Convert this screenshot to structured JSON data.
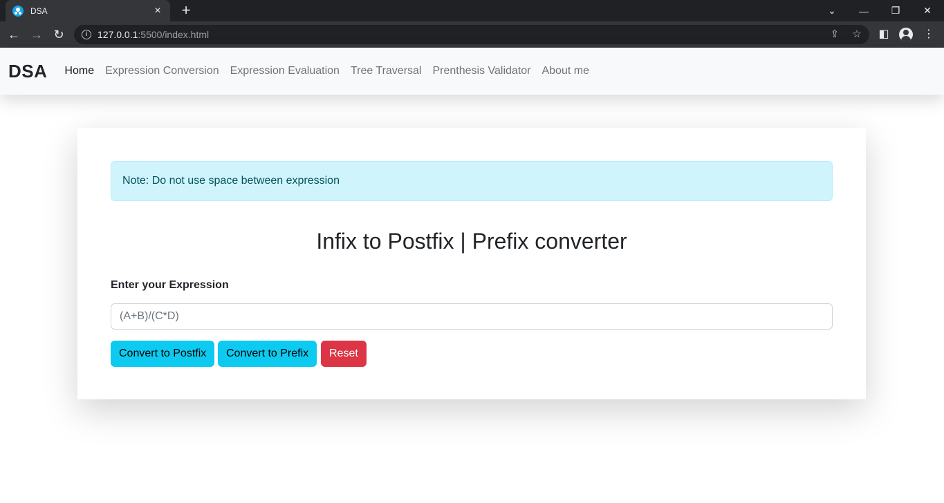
{
  "browser": {
    "tab_title": "DSA",
    "tab_close": "×",
    "new_tab": "+",
    "url_host": "127.0.0.1",
    "url_path": ":5500/index.html",
    "window_controls": [
      "⌄",
      "—",
      "❐",
      "✕"
    ]
  },
  "navbar": {
    "brand": "DSA",
    "links": [
      {
        "label": "Home",
        "active": true
      },
      {
        "label": "Expression Conversion",
        "active": false
      },
      {
        "label": "Expression Evaluation",
        "active": false
      },
      {
        "label": "Tree Traversal",
        "active": false
      },
      {
        "label": "Prenthesis Validator",
        "active": false
      },
      {
        "label": "About me",
        "active": false
      }
    ]
  },
  "main": {
    "note": "Note: Do not use space between expression",
    "heading": "Infix to Postfix | Prefix converter",
    "input_label": "Enter your Expression",
    "input_placeholder": "(A+B)/(C*D)",
    "buttons": {
      "postfix": "Convert to Postfix",
      "prefix": "Convert to Prefix",
      "reset": "Reset"
    }
  },
  "colors": {
    "info": "#0dcaf0",
    "danger": "#dc3545",
    "alert_bg": "#cff4fc"
  }
}
